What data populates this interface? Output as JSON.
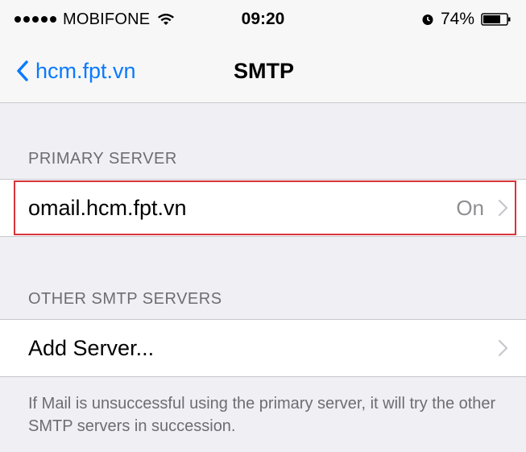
{
  "status_bar": {
    "carrier": "MOBIFONE",
    "time": "09:20",
    "battery": "74%"
  },
  "nav": {
    "back_label": "hcm.fpt.vn",
    "title": "SMTP"
  },
  "primary_section": {
    "header": "PRIMARY SERVER",
    "server_name": "omail.hcm.fpt.vn",
    "server_status": "On"
  },
  "other_section": {
    "header": "OTHER SMTP SERVERS",
    "add_label": "Add Server...",
    "footer": "If Mail is unsuccessful using the primary server, it will try the other SMTP servers in succession."
  },
  "colors": {
    "accent": "#0a7aff",
    "highlight": "#d9343a",
    "background": "#efeff4"
  },
  "icons": [
    "signal-dots-icon",
    "wifi-icon",
    "alarm-icon",
    "battery-icon",
    "back-chevron-icon",
    "chevron-right-icon"
  ]
}
